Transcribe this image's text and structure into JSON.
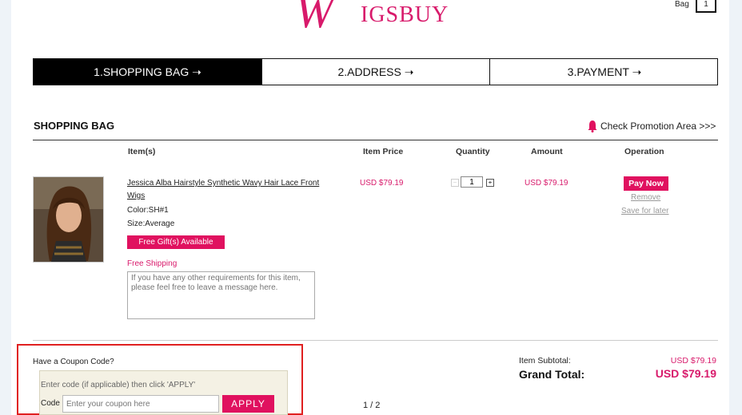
{
  "header": {
    "logo_initial": "W",
    "logo_rest": "IGSBUY",
    "bag_label": "Bag",
    "bag_count": "1"
  },
  "steps": [
    {
      "label": "1.SHOPPING BAG ➝",
      "active": true
    },
    {
      "label": "2.ADDRESS ➝",
      "active": false
    },
    {
      "label": "3.PAYMENT ➝",
      "active": false
    }
  ],
  "bag": {
    "title": "SHOPPING BAG",
    "promo_link": "Check Promotion Area >>>",
    "columns": {
      "items": "Item(s)",
      "price": "Item Price",
      "quantity": "Quantity",
      "amount": "Amount",
      "operation": "Operation"
    }
  },
  "item": {
    "name": "Jessica Alba Hairstyle Synthetic Wavy Hair Lace Front Wigs",
    "color": "Color:SH#1",
    "size": "Size:Average",
    "gift_button": "Free Gift(s) Available",
    "free_shipping": "Free Shipping",
    "message_placeholder": "If you have any other requirements for this item, please feel free to leave a message here.",
    "price": "USD $79.19",
    "quantity": "1",
    "amount": "USD $79.19",
    "pay_now": "Pay Now",
    "remove": "Remove",
    "save_later": "Save for later"
  },
  "coupon": {
    "title": "Have a Coupon Code?",
    "hint": "Enter code (if applicable) then click 'APPLY'",
    "code_label": "Code",
    "placeholder": "Enter your coupon here",
    "apply": "APPLY"
  },
  "pager": "1 / 2",
  "totals": {
    "subtotal_label": "Item Subtotal:",
    "subtotal": "USD $79.19",
    "grand_label": "Grand Total:",
    "grand": "USD $79.19"
  },
  "colors": {
    "brand": "#d81a6b",
    "button": "#e0115f",
    "highlight_border": "#e02020"
  },
  "icons": {
    "promo": "bell-icon",
    "qty_minus": "minus-icon",
    "qty_plus": "plus-icon"
  }
}
